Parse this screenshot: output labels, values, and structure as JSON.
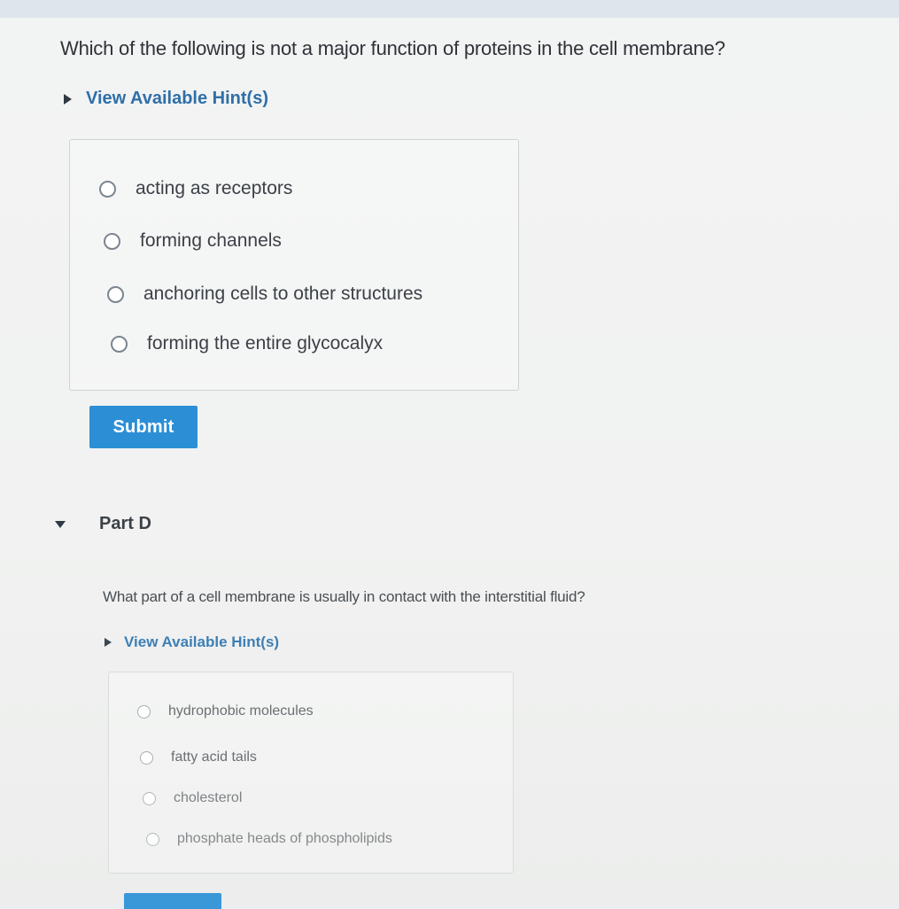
{
  "partC": {
    "question": "Which of the following is not a major function of proteins in the cell membrane?",
    "hint_label": "View Available Hint(s)",
    "choices": [
      "acting as receptors",
      "forming channels",
      "anchoring cells to other structures",
      "forming the entire glycocalyx"
    ],
    "submit_label": "Submit"
  },
  "partD": {
    "title": "Part D",
    "question": "What part of a cell membrane is usually in contact with the interstitial fluid?",
    "hint_label": "View Available Hint(s)",
    "choices": [
      "hydrophobic molecules",
      "fatty acid tails",
      "cholesterol",
      "phosphate heads of phospholipids"
    ]
  },
  "colors": {
    "accent": "#2c8fd6",
    "link": "#2f6fa8"
  },
  "icons": {
    "hint_toggle": "triangle-right-icon",
    "part_toggle": "triangle-down-icon",
    "radio": "radio-empty-icon"
  }
}
